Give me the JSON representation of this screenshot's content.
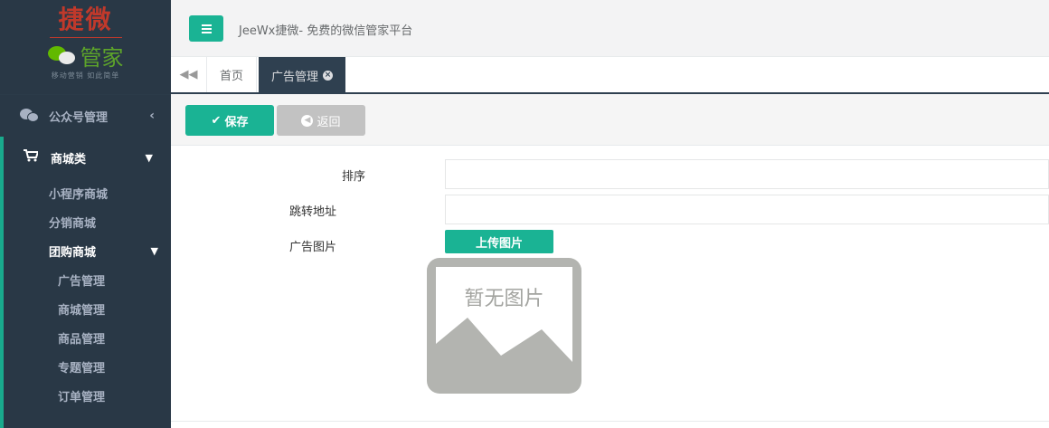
{
  "sidebar": {
    "logo_title": "捷微",
    "logo_sub": "管家",
    "logo_tagline": "移动营销 如此简单",
    "top_item": "公众号管理",
    "group": {
      "label": "商城类",
      "items": [
        {
          "label": "小程序商城"
        },
        {
          "label": "分销商城"
        },
        {
          "label": "团购商城"
        }
      ],
      "subitems": [
        {
          "label": "广告管理"
        },
        {
          "label": "商城管理"
        },
        {
          "label": "商品管理"
        },
        {
          "label": "专题管理"
        },
        {
          "label": "订单管理"
        }
      ]
    }
  },
  "header": {
    "title": "JeeWx捷微- 免费的微信管家平台"
  },
  "tabs": {
    "home": "首页",
    "current": "广告管理"
  },
  "toolbar": {
    "save_label": "保存",
    "back_label": "返回"
  },
  "form": {
    "sort_label": "排序",
    "sort_value": "",
    "url_label": "跳转地址",
    "url_value": "",
    "image_label": "广告图片",
    "upload_label": "上传图片",
    "no_image_text": "暂无图片"
  },
  "colors": {
    "accent": "#1ab394",
    "sidebar": "#2f4050",
    "sidebar_dark": "#293846",
    "logo_red": "#c0392b",
    "placeholder_gray": "#b3b4b0"
  }
}
